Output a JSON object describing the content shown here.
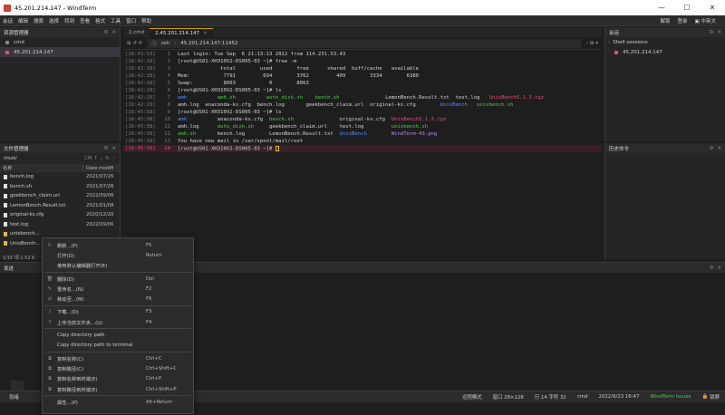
{
  "window": {
    "title": "45.201.214.147 - WindTerm",
    "buttons": [
      "—",
      "☐",
      "✕"
    ]
  },
  "menu": {
    "items": [
      "会话",
      "编辑",
      "搜索",
      "选择",
      "转到",
      "查看",
      "格式",
      "工具",
      "窗口",
      "帮助"
    ],
    "right": [
      "解锁",
      "登录",
      "▣ 中英文"
    ]
  },
  "resource_manager": {
    "title": "资源管理器",
    "items": [
      {
        "label": "cmd"
      },
      {
        "label": "45.201.214.147"
      }
    ]
  },
  "file_manager": {
    "title": "文件管理器",
    "path": "/root/",
    "path_tools": "CM  ↑  ⌄  ↻  ⋮",
    "columns": [
      "名称",
      "Date modifi"
    ],
    "files": [
      {
        "name": "bench.log",
        "date": "2021/07/26",
        "dir": false
      },
      {
        "name": "bench.sh",
        "date": "2021/07/26",
        "dir": false
      },
      {
        "name": "geekbench_claim.url",
        "date": "2022/09/06",
        "dir": false
      },
      {
        "name": "LemonBench.Result.txt",
        "date": "2021/01/08",
        "dir": false
      },
      {
        "name": "original-ks.cfg",
        "date": "2020/12/20",
        "dir": false
      },
      {
        "name": "test.log",
        "date": "2022/09/06",
        "dir": false
      },
      {
        "name": "unixbench...",
        "date": "",
        "dir": true
      },
      {
        "name": "UnixBench...",
        "date": "",
        "dir": true
      }
    ],
    "status": "1/15 项 1.52 K"
  },
  "tabs": [
    {
      "label": "1.cmd",
      "active": false
    },
    {
      "label": "2.45.201.214.147",
      "active": true
    }
  ],
  "address": {
    "icons": "⊞ ↺ ⟳",
    "info": "ⓘ",
    "scheme": "ssh",
    "host": "45.201.214.147:11452",
    "right": "›  ⊞  ▾"
  },
  "terminal": {
    "lines": [
      {
        "time": "16:43:53",
        "no": "1",
        "text": "Last login: Tue Sep  6 21:13:13 2022 from 114.231.53.43"
      },
      {
        "time": "16:42:18",
        "no": "2",
        "text": "[root@US01-XH310V2-DS005-03 ~]# free -m"
      },
      {
        "time": "16:42:18",
        "no": "3",
        "text": "              total        used        free      shared  buff/cache   available"
      },
      {
        "time": "16:42:18",
        "no": "4",
        "text": "Mem:           7791         694        3762         409        3334        6380"
      },
      {
        "time": "16:42:18",
        "no": "5",
        "text": "Swap:          8063           0        8063"
      },
      {
        "time": "16:42:29",
        "no": "6",
        "text": "[root@US01-XH310V2-DS005-03 ~]# ls"
      },
      {
        "time": "16:42:29",
        "no": "7",
        "text": "amh          amh.sh          auto_disk.sh    bench.sh               LemonBench.Result.txt  test.log   UnixBench5.1.3.tgz"
      },
      {
        "time": "16:42:29",
        "no": "8",
        "text": "amh.log  anaconda-ks.cfg  bench.log       geekbench_claim.url  original-ks.cfg        UnixBench   unixbench.sh"
      },
      {
        "time": "16:45:58",
        "no": "9",
        "text": "[root@US01-XH310V2-DS005-03 ~]# ls"
      },
      {
        "time": "16:45:58",
        "no": "10",
        "text": "amh          anaconda-ks.cfg  bench.sh               original-ks.cfg  UnixBench5.1.3.tgz"
      },
      {
        "time": "16:45:58",
        "no": "11",
        "text": "amh.log      auto_disk.sh     geekbench_claim.url    test.log         unixbench.sh"
      },
      {
        "time": "16:45:58",
        "no": "12",
        "text": "amh.sh       bench.log        LemonBench.Result.txt  UnixBench        WindTerm-43.png"
      },
      {
        "time": "16:45:58",
        "no": "13",
        "text": "You have new mail in /var/spool/mail/root"
      },
      {
        "time": "16:45:58",
        "no": "14",
        "text": "[root@US01-XH310V2-DS005-03 ~]# "
      }
    ]
  },
  "sessions": {
    "title": "会话",
    "group": "Shell sessions",
    "items": [
      {
        "label": "45.201.214.147"
      }
    ]
  },
  "history": {
    "title": "历史命令"
  },
  "send": {
    "title": "发送",
    "label": "就绪"
  },
  "statusbar": {
    "mode": "远程模式",
    "window": "窗口 28×128",
    "cursor": "行 14 字符 32",
    "shell": "cmd",
    "time": "2022/9/23 16:47",
    "issues": "WindTerm Issues",
    "lock": "锁屏"
  },
  "context_menu": {
    "groups": [
      [
        {
          "icon": "↻",
          "label": "刷新...(F)",
          "shortcut": "F5"
        },
        {
          "icon": "",
          "label": "打开(O)",
          "shortcut": "Return"
        },
        {
          "icon": "",
          "label": "使用默认编辑器打开(E)",
          "shortcut": ""
        }
      ],
      [
        {
          "icon": "🗑",
          "label": "删除(D)",
          "shortcut": "Del"
        },
        {
          "icon": "✎",
          "label": "重命名...(N)",
          "shortcut": "F2"
        },
        {
          "icon": "⇄",
          "label": "移动至...(M)",
          "shortcut": "F6"
        }
      ],
      [
        {
          "icon": "↓",
          "label": "下载...(D)",
          "shortcut": "F3"
        },
        {
          "icon": "↑",
          "label": "上传当前文件夹...(U)",
          "shortcut": "F4"
        }
      ],
      [
        {
          "icon": "",
          "label": "Copy directory path",
          "shortcut": ""
        },
        {
          "icon": "",
          "label": "Copy directory path to terminal",
          "shortcut": ""
        }
      ],
      [
        {
          "icon": "⧉",
          "label": "复制名称(C)",
          "shortcut": "Ctrl+C"
        },
        {
          "icon": "⧉",
          "label": "复制路径(C)",
          "shortcut": "Ctrl+Shift+C"
        },
        {
          "icon": "⧉",
          "label": "复制名称到终端(E)",
          "shortcut": "Ctrl+P"
        },
        {
          "icon": "⧉",
          "label": "复制路径到终端(E)",
          "shortcut": "Ctrl+Shift+P"
        }
      ],
      [
        {
          "icon": "",
          "label": "属性...(P)",
          "shortcut": "Alt+Return"
        }
      ]
    ]
  },
  "colors": {
    "accent": "#d4a200",
    "highlight_line": "#e04a6a",
    "green": "#4ec94e",
    "blue": "#5b8cff",
    "red": "#e0507a"
  }
}
